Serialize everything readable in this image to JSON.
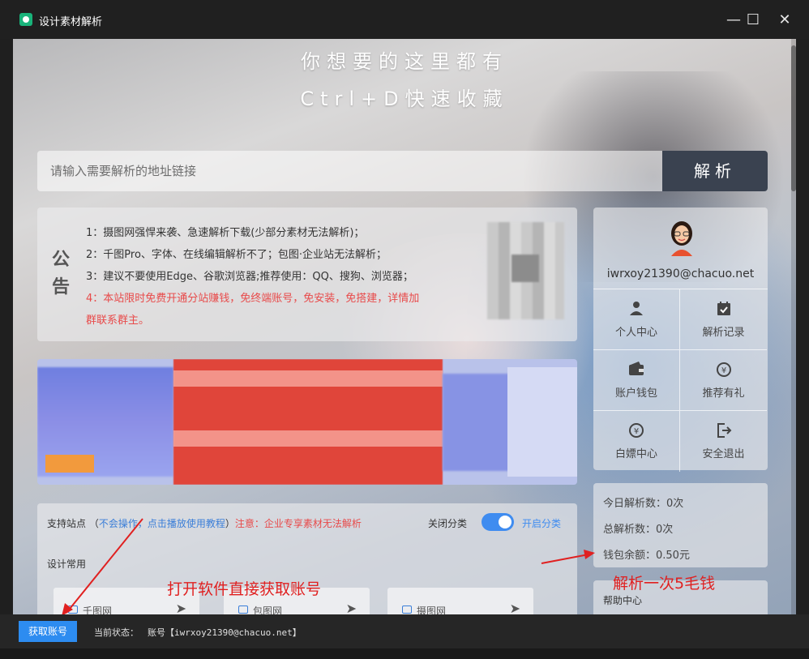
{
  "window": {
    "title": "设计素材解析",
    "controls": [
      "minimize",
      "maximize",
      "close"
    ]
  },
  "hero": {
    "line1": "你想要的这里都有",
    "line2": "Ctrl+D快速收藏"
  },
  "search": {
    "placeholder": "请输入需要解析的地址链接",
    "button_label": "解析"
  },
  "notice": {
    "title": "公告",
    "lines": [
      "1：摄图网强悍来袭、急速解析下载(少部分素材无法解析)；",
      "2：千图Pro、字体、在线编辑解析不了；包图·企业站无法解析；",
      "3：建议不要使用Edge、谷歌浏览器;推荐使用：QQ、搜狗、浏览器；",
      "4：本站限时免费开通分站赚钱，免终端账号，免安装，免搭建，详情加",
      "群联系群主。"
    ]
  },
  "user": {
    "username": "iwrxoy21390@chacuo.net",
    "menu": [
      {
        "label": "个人中心",
        "icon": "user-icon"
      },
      {
        "label": "解析记录",
        "icon": "calendar-check-icon"
      },
      {
        "label": "账户钱包",
        "icon": "wallet-icon"
      },
      {
        "label": "推荐有礼",
        "icon": "yen-gift-icon"
      },
      {
        "label": "白嫖中心",
        "icon": "yen-circle-icon"
      },
      {
        "label": "安全退出",
        "icon": "logout-icon"
      }
    ]
  },
  "stats": {
    "today": "今日解析数：0次",
    "total": "总解析数：0次",
    "balance": "钱包余额：0.50元"
  },
  "help": {
    "title": "帮助中心"
  },
  "sites": {
    "label": "支持站点",
    "open_paren": "（",
    "tutorial_link": "不会操作，点击播放使用教程",
    "close_paren": "）",
    "warning": "注意：企业专享素材无法解析",
    "toggle_off_label": "关闭分类",
    "toggle_on_label": "开启分类",
    "toggle_state": "on",
    "group_title": "设计常用",
    "items": [
      {
        "name": "千图网"
      },
      {
        "name": "包图网"
      },
      {
        "name": "摄图网"
      }
    ]
  },
  "annotations": {
    "account_tip": "打开软件直接获取账号",
    "price_tip": "解析一次5毛钱"
  },
  "statusbar": {
    "button_label": "获取账号",
    "state_label": "当前状态：",
    "state_value": "账号【iwrxoy21390@chacuo.net】"
  },
  "colors": {
    "accent": "#2d8cf0",
    "warning": "#e84a4a",
    "search_button": "#3a4250",
    "annotation": "#e02020"
  }
}
